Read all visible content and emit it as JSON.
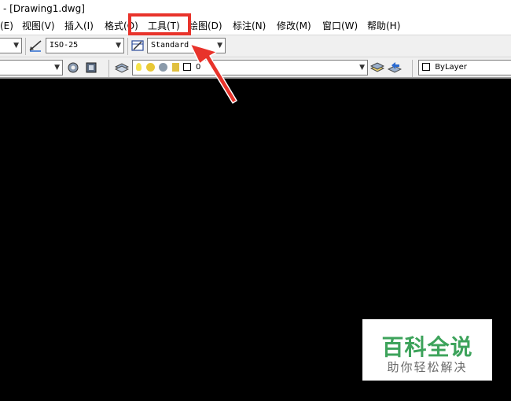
{
  "window": {
    "title": "- [Drawing1.dwg]"
  },
  "menubar": {
    "items": [
      {
        "label": "(E)"
      },
      {
        "label": "视图(V)"
      },
      {
        "label": "插入(I)"
      },
      {
        "label": "格式(O)"
      },
      {
        "label": "工具(T)"
      },
      {
        "label": "绘图(D)"
      },
      {
        "label": "标注(N)"
      },
      {
        "label": "修改(M)"
      },
      {
        "label": "窗口(W)"
      },
      {
        "label": "帮助(H)"
      }
    ]
  },
  "toolbar1": {
    "dimstyle_value": "ISO-25",
    "tablestyle_value": "Standard"
  },
  "toolbar2": {
    "layer_value": "0",
    "color_value": "ByLayer"
  },
  "annotation": {
    "color": "#e8332b"
  },
  "watermark": {
    "title": "百科全说",
    "subtitle": "助你轻松解决"
  }
}
